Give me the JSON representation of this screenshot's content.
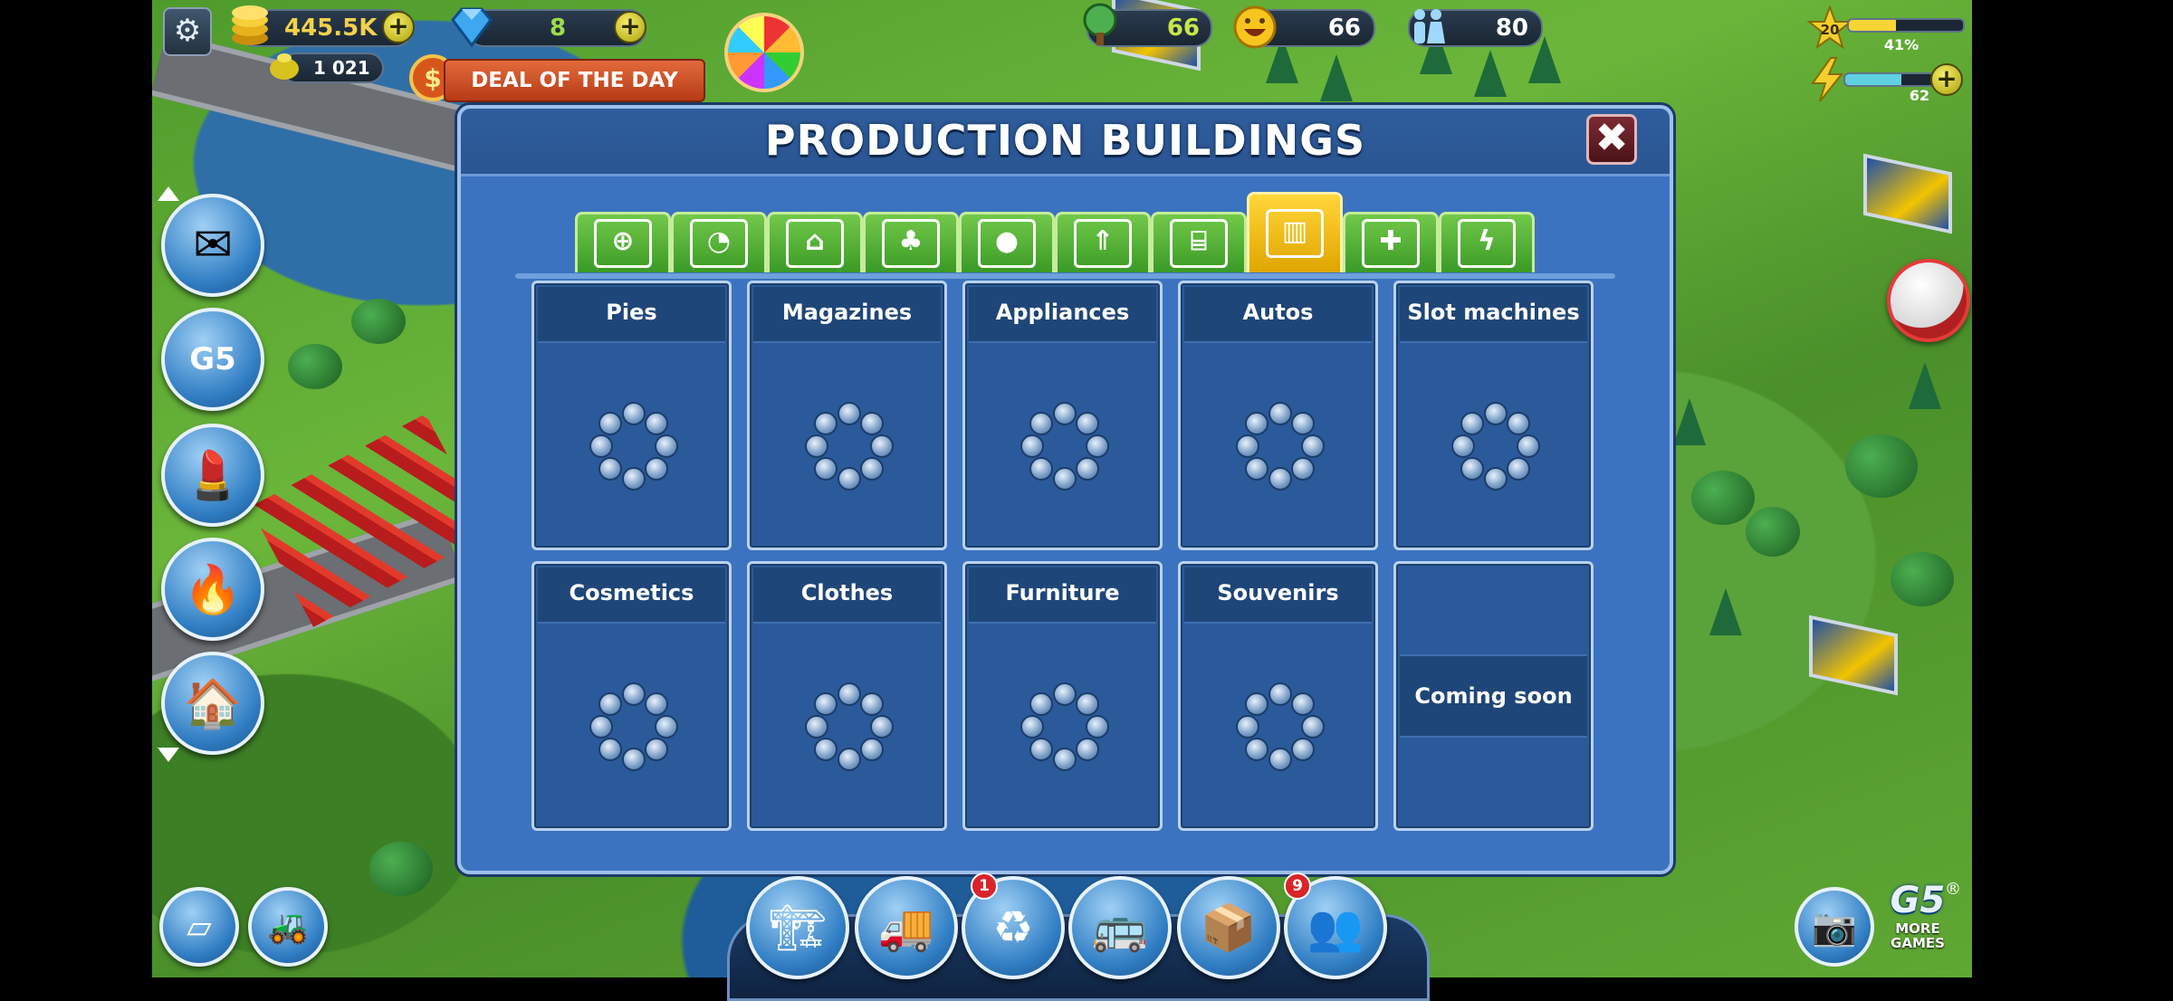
{
  "hud": {
    "coins": "445.5K",
    "gems": "8",
    "subcoins": "1 021",
    "deal_label": "DEAL OF THE DAY",
    "eco": "66",
    "happiness": "66",
    "population": "80",
    "level": "20",
    "xp_percent_label": "41%",
    "xp_fraction": 0.41,
    "energy": "62",
    "energy_fraction": 0.62
  },
  "dialog": {
    "title": "PRODUCTION BUILDINGS",
    "tabs": [
      {
        "icon": "add-document-icon"
      },
      {
        "icon": "leisure-icon"
      },
      {
        "icon": "house-icon"
      },
      {
        "icon": "park-tree-icon"
      },
      {
        "icon": "bowling-icon"
      },
      {
        "icon": "rocket-icon"
      },
      {
        "icon": "government-building-icon"
      },
      {
        "icon": "factory-icon",
        "active": true
      },
      {
        "icon": "shield-plus-icon"
      },
      {
        "icon": "battery-icon"
      }
    ],
    "cards": [
      {
        "title": "Pies"
      },
      {
        "title": "Magazines"
      },
      {
        "title": "Appliances"
      },
      {
        "title": "Autos"
      },
      {
        "title": "Slot machines"
      },
      {
        "title": "Cosmetics"
      },
      {
        "title": "Clothes"
      },
      {
        "title": "Furniture"
      },
      {
        "title": "Souvenirs"
      },
      {
        "title": "",
        "coming_soon": "Coming soon"
      }
    ]
  },
  "bottom": {
    "recycle_badge": "1",
    "social_badge": "9",
    "more_games_brand": "G5",
    "more_games_label": "MORE GAMES",
    "registered_mark": "®"
  },
  "colors": {
    "dialog_bg": "#3b73c0",
    "tab_green": "#3a9a25",
    "tab_active": "#e0a500",
    "coin_gold": "#f2d14b"
  }
}
